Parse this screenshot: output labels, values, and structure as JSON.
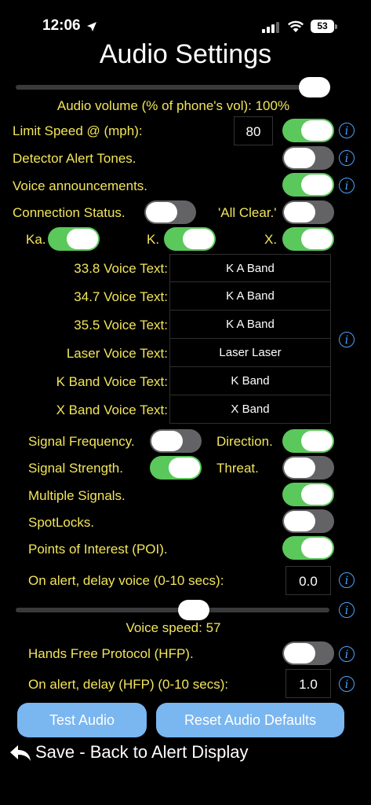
{
  "status_bar": {
    "time": "12:06",
    "battery": "53"
  },
  "title": "Audio Settings",
  "audio_volume": {
    "label": "Audio volume (% of phone's vol): 100%",
    "level": 1.0
  },
  "limit_speed": {
    "label": "Limit Speed @ (mph):",
    "value": "80",
    "enabled": true
  },
  "detector_alert_tones": {
    "label": "Detector Alert Tones.",
    "enabled": false
  },
  "voice_announcements": {
    "label": "Voice announcements.",
    "enabled": true
  },
  "connection_status": {
    "label": "Connection Status.",
    "enabled": false
  },
  "all_clear": {
    "label": "'All Clear.'",
    "enabled": false
  },
  "bands": [
    {
      "label": "Ka.",
      "enabled": true
    },
    {
      "label": "K.",
      "enabled": true
    },
    {
      "label": "X.",
      "enabled": true
    }
  ],
  "voice_texts": [
    {
      "label": "33.8 Voice Text:",
      "value": "K A Band"
    },
    {
      "label": "34.7 Voice Text:",
      "value": "K A Band"
    },
    {
      "label": "35.5 Voice Text:",
      "value": "K A Band"
    },
    {
      "label": "Laser Voice Text:",
      "value": "Laser Laser"
    },
    {
      "label": "K Band Voice Text:",
      "value": "K Band"
    },
    {
      "label": "X Band Voice Text:",
      "value": "X Band"
    }
  ],
  "signal_frequency": {
    "label": "Signal Frequency.",
    "enabled": false
  },
  "direction": {
    "label": "Direction.",
    "enabled": true
  },
  "signal_strength": {
    "label": "Signal Strength.",
    "enabled": true
  },
  "threat": {
    "label": "Threat.",
    "enabled": false
  },
  "multiple_signals": {
    "label": "Multiple Signals.",
    "enabled": true
  },
  "spotlocks": {
    "label": "SpotLocks.",
    "enabled": false
  },
  "poi": {
    "label": "Points of Interest (POI).",
    "enabled": true
  },
  "delay_voice": {
    "label": "On alert, delay voice (0-10 secs):",
    "value": "0.0"
  },
  "voice_speed": {
    "label": "Voice speed: 57",
    "level": 0.57
  },
  "hfp": {
    "label": "Hands Free Protocol (HFP).",
    "enabled": false
  },
  "delay_hfp": {
    "label": "On alert, delay (HFP) (0-10 secs):",
    "value": "1.0"
  },
  "buttons": {
    "test_audio": "Test Audio",
    "reset_defaults": "Reset Audio Defaults"
  },
  "save_back": "Save - Back to Alert Display",
  "info_glyph": "i",
  "colors": {
    "accent_green": "#5ac85a",
    "label_yellow": "#f2e55a",
    "button_blue": "#7ab6f0",
    "info_blue": "#4aa3ff"
  }
}
